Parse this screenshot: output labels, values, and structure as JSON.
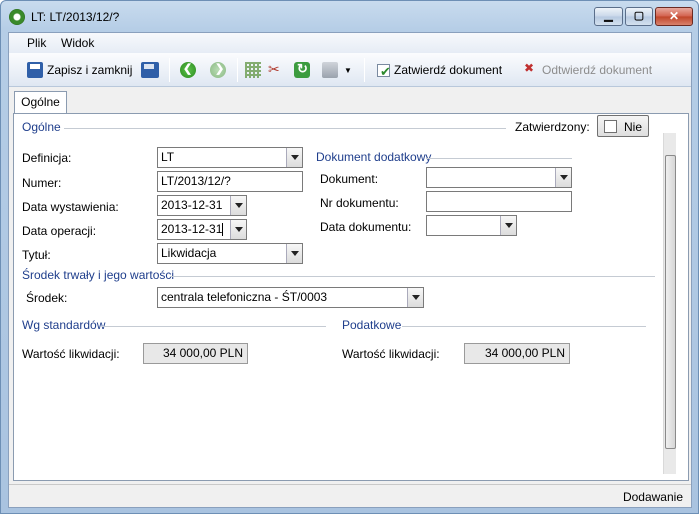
{
  "window": {
    "title": "LT: LT/2013/12/?"
  },
  "menu": {
    "items": [
      "Plik",
      "Widok"
    ]
  },
  "toolbar": {
    "save_close": "Zapisz i zamknij",
    "approve": "Zatwierdź dokument",
    "unapprove": "Odtwierdź dokument"
  },
  "tabs": [
    "Ogólne"
  ],
  "general": {
    "group_title": "Ogólne",
    "approved_label": "Zatwierdzony:",
    "approved_value": "Nie",
    "definition_label": "Definicja:",
    "definition_value": "LT",
    "number_label": "Numer:",
    "number_value": "LT/2013/12/?",
    "issue_date_label": "Data wystawienia:",
    "issue_date_value": "2013-12-31",
    "operation_date_label": "Data operacji:",
    "operation_date_value": "2013-12-31",
    "title_label": "Tytuł:",
    "title_value": "Likwidacja"
  },
  "additional_doc": {
    "group_title": "Dokument dodatkowy",
    "document_label": "Dokument:",
    "document_value": "",
    "doc_number_label": "Nr dokumentu:",
    "doc_number_value": "",
    "doc_date_label": "Data dokumentu:",
    "doc_date_value": ""
  },
  "asset": {
    "group_title": "Środek trwały i jego wartości",
    "asset_label": "Środek:",
    "asset_value": "centrala telefoniczna - ŚT/0003"
  },
  "standards": {
    "group_title": "Wg standardów",
    "value_label": "Wartość likwidacji:",
    "value": "34 000,00 PLN"
  },
  "tax": {
    "group_title": "Podatkowe",
    "value_label": "Wartość likwidacji:",
    "value": "34 000,00 PLN"
  },
  "status": {
    "text": "Dodawanie"
  }
}
